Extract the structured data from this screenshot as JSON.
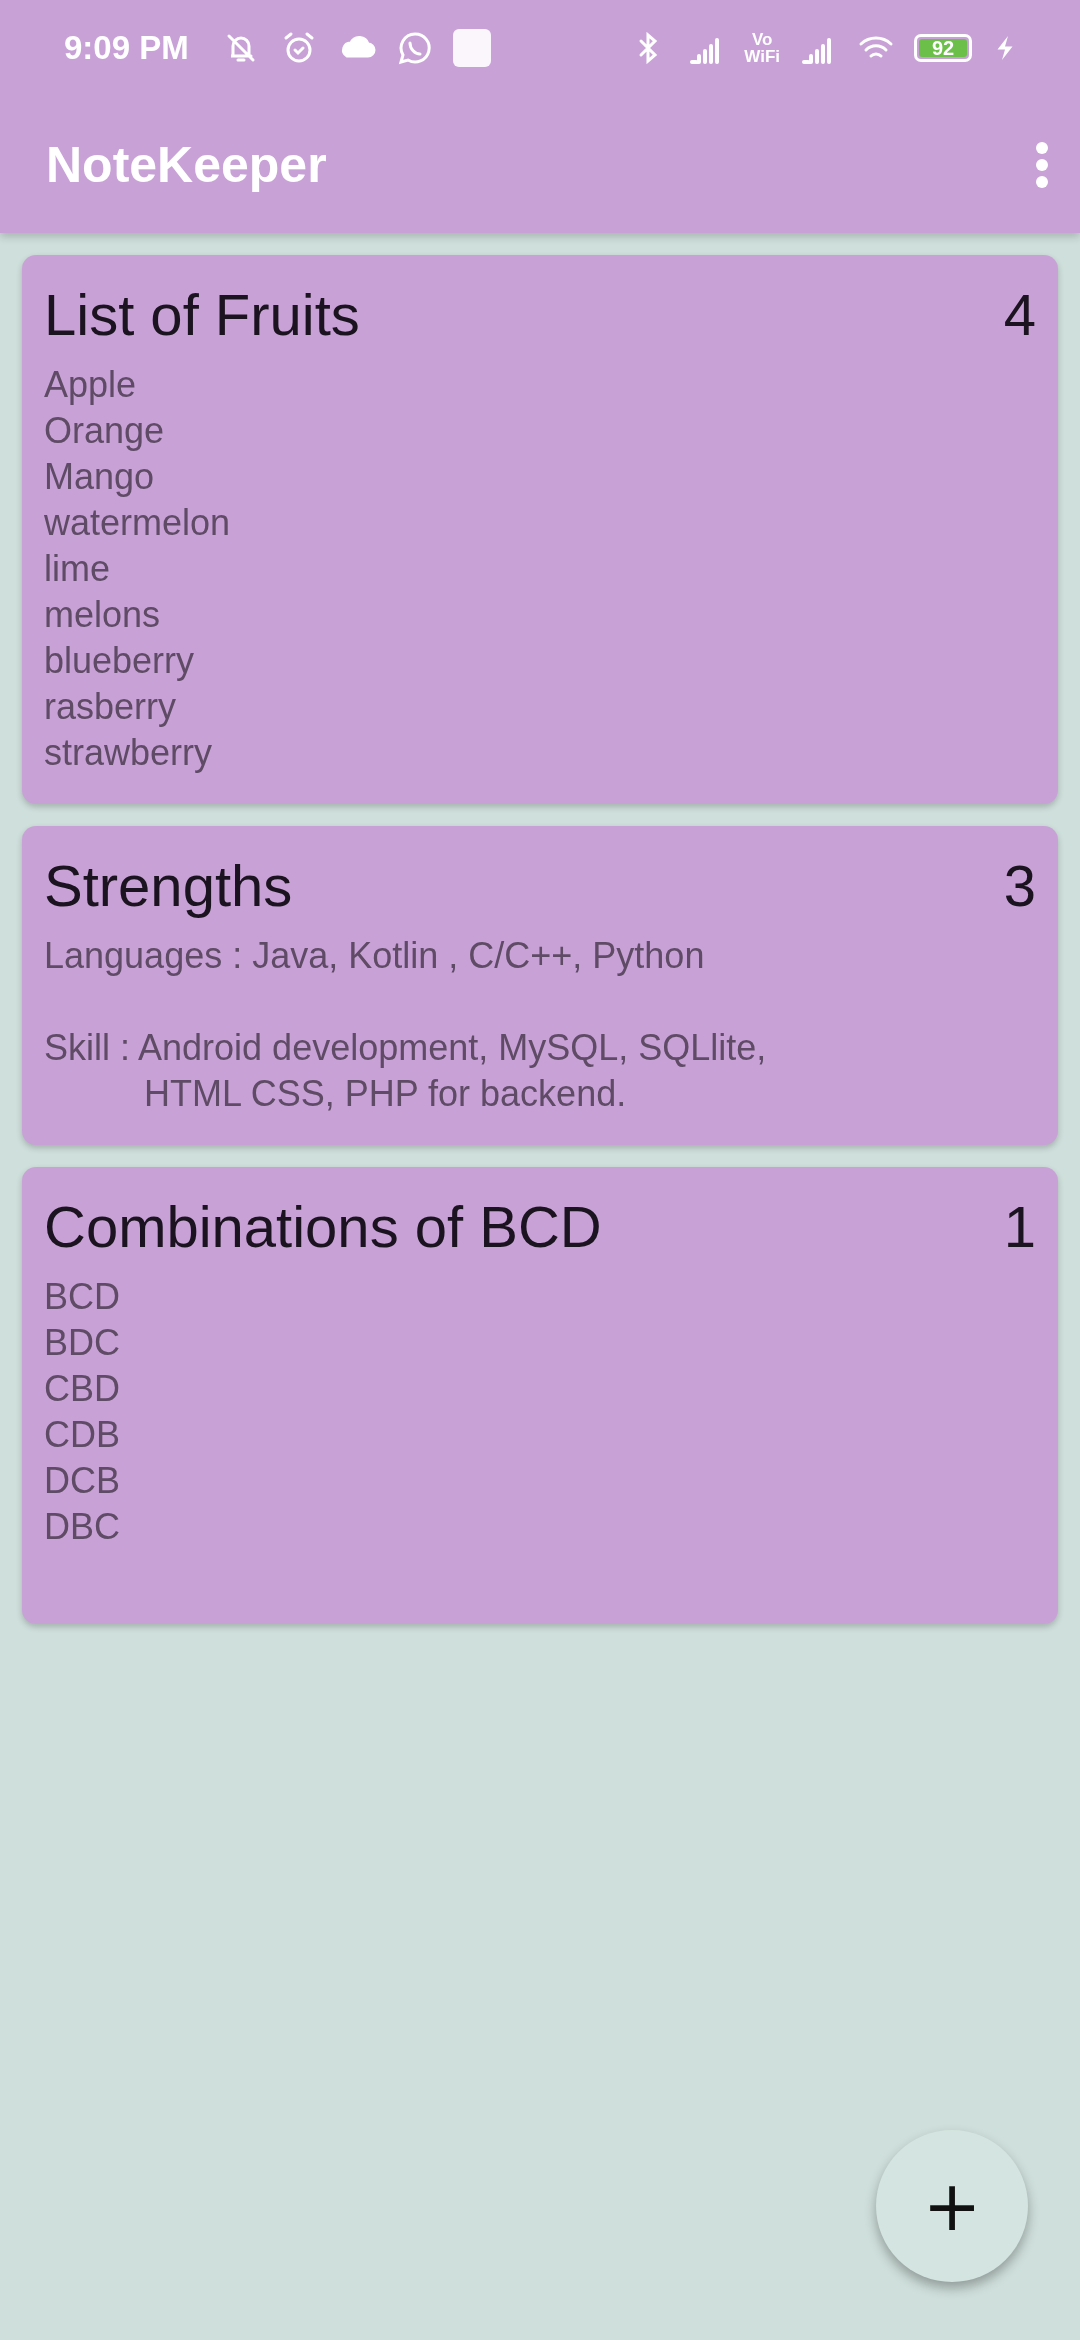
{
  "status_bar": {
    "time": "9:09 PM",
    "vowifi": [
      "Vo",
      "WiFi"
    ],
    "battery": "92",
    "charging": true
  },
  "app_bar": {
    "title": "NoteKeeper"
  },
  "notes": [
    {
      "title": "List of Fruits",
      "count": "4",
      "paragraphs": [
        {
          "kind": "plain",
          "lines": [
            "Apple",
            "Orange",
            "Mango",
            "watermelon",
            "lime",
            "melons",
            "blueberry",
            "rasberry",
            "strawberry"
          ]
        }
      ]
    },
    {
      "title": "Strengths",
      "count": "3",
      "paragraphs": [
        {
          "kind": "plain",
          "lines": [
            "Languages : Java, Kotlin , C/C++, Python"
          ]
        },
        {
          "kind": "hanging",
          "lines": [
            "Skill : Android development, MySQL, SQLlite,",
            "HTML CSS, PHP for backend."
          ]
        }
      ]
    },
    {
      "title": "Combinations of BCD",
      "count": "1",
      "trailing_blank": true,
      "paragraphs": [
        {
          "kind": "plain",
          "lines": [
            "BCD",
            "BDC",
            "CBD",
            "CDB",
            "DCB",
            "DBC"
          ]
        }
      ]
    }
  ],
  "fab": {
    "label": "+"
  }
}
